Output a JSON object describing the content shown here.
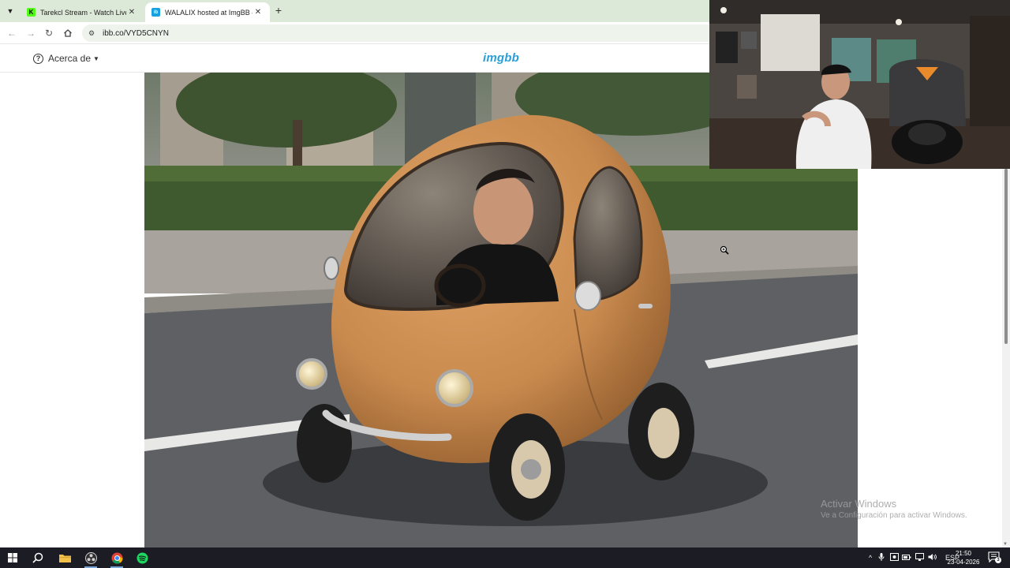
{
  "browser": {
    "tabs": [
      {
        "title": "Tarekcl Stream - Watch Live on ",
        "favicon": "kick-favicon",
        "active": false
      },
      {
        "title": "WALALIX hosted at ImgBB — I",
        "favicon": "imgbb-favicon",
        "active": true
      }
    ],
    "close_glyph": "✕",
    "new_tab_glyph": "+",
    "url": "ibb.co/VYD5CNYN"
  },
  "site": {
    "about_label": "Acerca de",
    "logo_text": "imgbb"
  },
  "image": {
    "subject": "orange-egg-shaped-car-with-driver",
    "colors": {
      "car_body": "#c98a4e",
      "road": "#5e6064",
      "hedge": "#3f5a2e",
      "sidewalk": "#a8a39c"
    }
  },
  "watermark": {
    "line1": "Activar Windows",
    "line2": "Ve a Configuración para activar Windows."
  },
  "taskbar": {
    "apps": [
      "windows-start-icon",
      "search-icon",
      "file-explorer-icon",
      "obs-icon",
      "chrome-icon",
      "spotify-icon"
    ],
    "tray_icons": [
      "chevron-up-icon",
      "microphone-icon",
      "camera-icon",
      "battery-icon",
      "network-icon",
      "volume-icon"
    ],
    "language": "ESP",
    "time": "21:50",
    "date": "23-04-2026",
    "notifications": "3"
  },
  "colors": {
    "tabstrip": "#dce8d8",
    "logo": "#2a9fd6",
    "taskbar": "#1c1c24"
  }
}
